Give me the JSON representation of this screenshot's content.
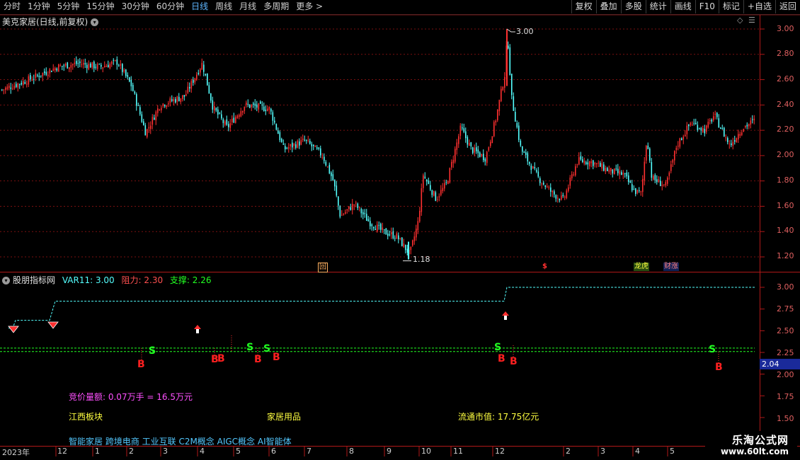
{
  "toolbar": {
    "periods": [
      "分时",
      "1分钟",
      "5分钟",
      "15分钟",
      "30分钟",
      "60分钟",
      "日线",
      "周线",
      "月线",
      "多周期",
      "更多 >"
    ],
    "active_period": "日线",
    "right_buttons": [
      "复权",
      "叠加",
      "多股",
      "统计",
      "画线",
      "F10",
      "标记",
      "+自选",
      "返回"
    ]
  },
  "main_chart": {
    "title": "美克家居(日线,前复权)",
    "y_ticks": [
      "3.00",
      "2.80",
      "2.60",
      "2.40",
      "2.20",
      "2.00",
      "1.80",
      "1.60",
      "1.40",
      "1.20"
    ],
    "high_label": "3.00",
    "low_label": "1.18",
    "markers": [
      {
        "text": "回",
        "color": "#ffb060"
      },
      {
        "text": "$",
        "color": "#ff3030"
      },
      {
        "text": "龙虎",
        "color": "#ffff40"
      },
      {
        "text": "财涨",
        "color": "#ff8080"
      }
    ]
  },
  "indicator": {
    "title": "股朋指标网",
    "var_label": "VAR11: 3.00",
    "resist_label": "阻力: 2.30",
    "support_label": "支撑: 2.26",
    "y_ticks": [
      "3.00",
      "2.75",
      "2.50",
      "2.25",
      "2.00",
      "1.75",
      "1.50"
    ],
    "current_value": "2.04",
    "signals_b": [
      "B",
      "B",
      "B",
      "B",
      "B",
      "B",
      "B",
      "B"
    ],
    "signals_s": [
      "S",
      "S",
      "S",
      "S",
      "S"
    ],
    "bid_label": "竞价量额: 0.07万手 = 16.5万元",
    "region": "江西板块",
    "industry": "家居用品",
    "market_cap": "流通市值: 17.75亿元",
    "concepts": "智能家居 跨境电商 工业互联 C2M概念 AIGC概念 AI智能体"
  },
  "x_axis": {
    "labels": [
      "2023年",
      "12",
      "1",
      "2",
      "3",
      "4",
      "5",
      "6",
      "7",
      "8",
      "9",
      "10",
      "11",
      "12",
      "2",
      "3",
      "4",
      "5"
    ]
  },
  "watermark": {
    "line1": "乐淘公式网",
    "line2": "www.60lt.com"
  },
  "colors": {
    "up": "#ff3030",
    "down": "#54ffff",
    "grid": "#7a1010",
    "resist": "#22ff22",
    "var": "#54ffff"
  }
}
